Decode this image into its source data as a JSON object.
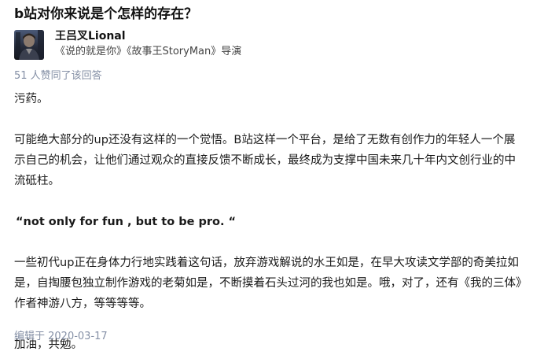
{
  "question": {
    "title": "b站对你来说是个怎样的存在？"
  },
  "author": {
    "name": "王吕叉Lional",
    "headline": "《说的就是你》《故事王StoryMan》导演"
  },
  "answer": {
    "vote_text": "51 人赞同了该回答",
    "paragraphs": [
      "污药。",
      "可能绝大部分的up还没有这样的一个觉悟。B站这样一个平台，是给了无数有创作力的年轻人一个展示自己的机会，让他们通过观众的直接反馈不断成长，最终成为支撑中国未来几十年内文创行业的中流砥柱。",
      "“not only for fun , but to be pro. “",
      "一些初代up正在身体力行地实践着这句话，放弃游戏解说的水王如是，在早大攻读文学部的奇美拉如是，自掏腰包独立制作游戏的老菊如是，不断摸着石头过河的我也如是。哦，对了，还有《我的三体》作者神游八方，等等等等。",
      "加油，共勉。"
    ],
    "edit_time": "编辑于 2020-03-17"
  }
}
